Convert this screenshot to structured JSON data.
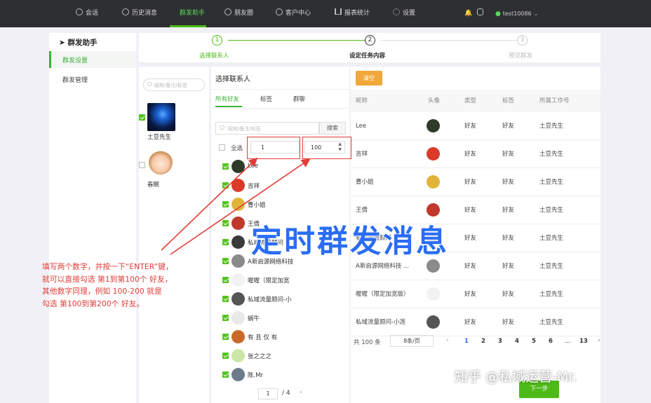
{
  "topnav": {
    "items": [
      {
        "label": "会话",
        "icon": "chat-icon"
      },
      {
        "label": "历史消息",
        "icon": "clock-icon"
      },
      {
        "label": "群发助手",
        "icon": "",
        "active": true
      },
      {
        "label": "朋友圈",
        "icon": "moments-icon"
      },
      {
        "label": "客户中心",
        "icon": "user-icon"
      },
      {
        "label": "报表统计",
        "icon": "bar-chart-icon"
      },
      {
        "label": "设置",
        "icon": "gear-icon"
      }
    ],
    "user": "test10086",
    "active_color": "#4cbb17"
  },
  "sidebar": {
    "title": "群发助手",
    "items": [
      {
        "label": "群发设置",
        "active": true
      },
      {
        "label": "群发管理",
        "active": false
      }
    ]
  },
  "steps": [
    {
      "num": "1",
      "label": "选择联系人",
      "state": "done"
    },
    {
      "num": "2",
      "label": "设定任务内容",
      "state": "current"
    },
    {
      "num": "3",
      "label": "预览群发",
      "state": "todo"
    }
  ],
  "accounts": {
    "search_placeholder": "昵称/备注/标签",
    "items": [
      {
        "name": "土豆先生",
        "checked": true
      },
      {
        "name": "春眠",
        "checked": false
      }
    ]
  },
  "contacts": {
    "title": "选择联系人",
    "tabs": [
      "所有好友",
      "标签",
      "群聊"
    ],
    "search_placeholder": "昵称/备注/标签",
    "search_button": "搜索",
    "select_all": "全选",
    "range_from": "1",
    "range_to": "100",
    "list": [
      "Lee",
      "吉祥",
      "曹小姐",
      "王倩",
      "私域流量顾问",
      "A新启源网络科技",
      "喔喔（限定加宽",
      "私域流量顾问-小",
      "蜗牛",
      "有 且 仅 有",
      "张之之之",
      "陈.Mr"
    ],
    "page_current": "1",
    "page_total": "/ 4"
  },
  "table": {
    "clear_button": "清空",
    "headers": [
      "昵称",
      "头像",
      "类型",
      "标签",
      "所属工作号"
    ],
    "rows": [
      {
        "nick": "Lee",
        "type": "好友",
        "tag": "好友",
        "owner": "土豆先生"
      },
      {
        "nick": "吉祥",
        "type": "好友",
        "tag": "好友",
        "owner": "土豆先生"
      },
      {
        "nick": "曹小姐",
        "type": "好友",
        "tag": "好友",
        "owner": "土豆先生"
      },
      {
        "nick": "王倩",
        "type": "好友",
        "tag": "好友",
        "owner": "土豆先生"
      },
      {
        "nick": "私域流量顾问",
        "type": "好友",
        "tag": "好友",
        "owner": "土豆先生"
      },
      {
        "nick": "A新启源网络科技 ...",
        "type": "好友",
        "tag": "好友",
        "owner": "土豆先生"
      },
      {
        "nick": "喔喔（限定加宽版）",
        "type": "好友",
        "tag": "好友",
        "owner": "土豆先生"
      },
      {
        "nick": "私域流量顾问-小莲",
        "type": "好友",
        "tag": "好友",
        "owner": "土豆先生"
      }
    ],
    "total": "共 100 条",
    "page_size": "8条/页",
    "pages": [
      "1",
      "2",
      "3",
      "4",
      "5",
      "6",
      "...",
      "13"
    ],
    "next_button": "下一步"
  },
  "overlay": {
    "title": "定时群发消息",
    "title_color": "#2a6df4",
    "note_lines": [
      "填写两个数字，并按一下“ENTER”键，",
      "就可以直接勾选 第1到第100个 好友，",
      "其他数字同理，例如 100-200 就是",
      "勾选 第100到第200个 好友。"
    ],
    "note_color": "#e23c36",
    "watermark": "知乎 @私域运营-Mr."
  }
}
